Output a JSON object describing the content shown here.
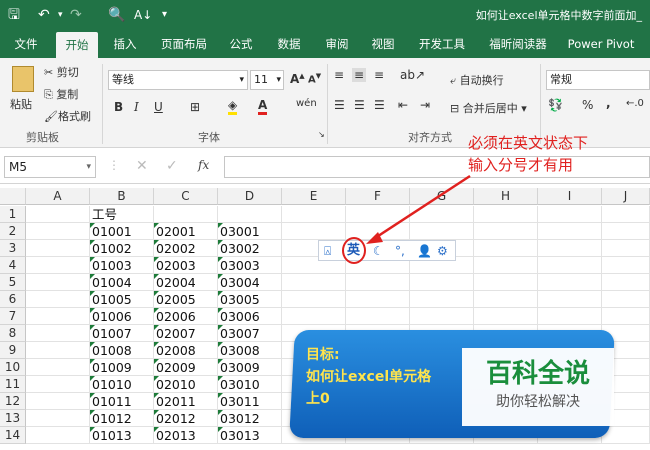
{
  "window": {
    "title": "如何让excel单元格中数字前面加_"
  },
  "quick_access": {
    "icons": [
      "save-icon",
      "undo-icon",
      "redo-icon",
      "print-preview-icon",
      "sort-icon",
      "customize-icon"
    ]
  },
  "tabs": [
    "文件",
    "开始",
    "插入",
    "页面布局",
    "公式",
    "数据",
    "审阅",
    "视图",
    "开发工具",
    "福昕阅读器",
    "Power Pivot"
  ],
  "ribbon": {
    "cut": "剪切",
    "copy": "复制",
    "paste": "粘贴",
    "format_painter": "格式刷",
    "clipboard_group": "剪贴板",
    "font_name": "等线",
    "font_size": "11",
    "font_group": "字体",
    "wrap_text": "自动换行",
    "merge_center": "合并后居中",
    "alignment_group": "对齐方式",
    "number_format": "常规",
    "percent": "%",
    "comma": ","
  },
  "formula_bar": {
    "name_box": "M5",
    "fx": "fx",
    "value": ""
  },
  "grid": {
    "columns": [
      "A",
      "B",
      "C",
      "D",
      "E",
      "F",
      "G",
      "H",
      "I",
      "J"
    ],
    "rows": [
      "1",
      "2",
      "3",
      "4",
      "5",
      "6",
      "7",
      "8",
      "9",
      "10",
      "11",
      "12",
      "13",
      "14"
    ],
    "header_cell": "工号",
    "col_b": [
      "01001",
      "01002",
      "01003",
      "01004",
      "01005",
      "01006",
      "01007",
      "01008",
      "01009",
      "01010",
      "01011",
      "01012",
      "01013"
    ],
    "col_c": [
      "02001",
      "02002",
      "02003",
      "02004",
      "02005",
      "02006",
      "02007",
      "02008",
      "02009",
      "02010",
      "02011",
      "02012",
      "02013"
    ],
    "col_d": [
      "03001",
      "03002",
      "03003",
      "03004",
      "03005",
      "03006",
      "03007",
      "03008",
      "03009",
      "03010",
      "03011",
      "03012",
      "03013"
    ]
  },
  "ime_toolbar": {
    "lang": "英"
  },
  "annotation": {
    "line1": "必须在英文状态下",
    "line2": "输入分号才有用"
  },
  "goal_box": {
    "label": "目标:",
    "line1": "如何让excel单元格",
    "line2": "上0"
  },
  "watermark": {
    "main": "百科全说",
    "sub": "助你轻松解决"
  }
}
